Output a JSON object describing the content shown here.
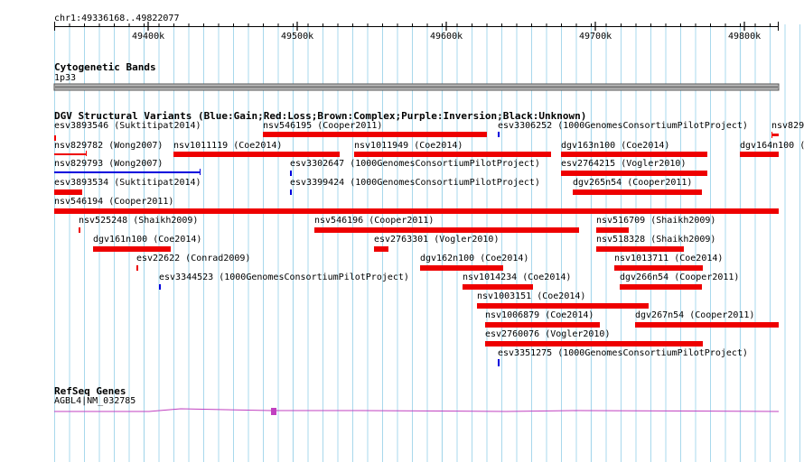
{
  "colors": {
    "gridline": "#a8d8ec",
    "loss": "#ee0000",
    "gain": "#0000dd",
    "gene": "#c040c0",
    "band": "#888888",
    "ruler": "#000000"
  },
  "ruler": {
    "title": "chr1:49336168..49822077",
    "ticks": [
      "49400k",
      "49500k",
      "49600k",
      "49700k",
      "49800k"
    ]
  },
  "cytoband": {
    "title": "Cytogenetic Bands",
    "band_label": "1p33"
  },
  "dgv": {
    "title": "DGV Structural Variants (Blue:Gain;Red:Loss;Brown:Complex;Purple:Inversion;Black:Unknown)",
    "features": [
      {
        "label": "esv3893546 (Suktitipat2014)",
        "type": "loss"
      },
      {
        "label": "nsv546195 (Cooper2011)",
        "type": "loss"
      },
      {
        "label": "esv3306252 (1000GenomesConsortiumPilotProject)",
        "type": "gain"
      },
      {
        "label": "nsv829",
        "type": "loss"
      },
      {
        "label": "nsv829782 (Wong2007)",
        "type": "loss"
      },
      {
        "label": "nsv1011119 (Coe2014)",
        "type": "loss"
      },
      {
        "label": "nsv1011949 (Coe2014)",
        "type": "loss"
      },
      {
        "label": "dgv163n100 (Coe2014)",
        "type": "loss"
      },
      {
        "label": "dgv164n100 (Co",
        "type": "loss"
      },
      {
        "label": "nsv829793 (Wong2007)",
        "type": "gain"
      },
      {
        "label": "esv3302647 (1000GenomesConsortiumPilotProject)",
        "type": "gain"
      },
      {
        "label": "esv2764215 (Vogler2010)",
        "type": "loss"
      },
      {
        "label": "esv3893534 (Suktitipat2014)",
        "type": "loss"
      },
      {
        "label": "esv3399424 (1000GenomesConsortiumPilotProject)",
        "type": "gain"
      },
      {
        "label": "dgv265n54 (Cooper2011)",
        "type": "loss"
      },
      {
        "label": "nsv546194 (Cooper2011)",
        "type": "loss"
      },
      {
        "label": "nsv525248 (Shaikh2009)",
        "type": "loss"
      },
      {
        "label": "nsv546196 (Cooper2011)",
        "type": "loss"
      },
      {
        "label": "nsv516709 (Shaikh2009)",
        "type": "loss"
      },
      {
        "label": "dgv161n100 (Coe2014)",
        "type": "loss"
      },
      {
        "label": "esv2763301 (Vogler2010)",
        "type": "loss"
      },
      {
        "label": "nsv518328 (Shaikh2009)",
        "type": "loss"
      },
      {
        "label": "esv22622 (Conrad2009)",
        "type": "loss"
      },
      {
        "label": "dgv162n100 (Coe2014)",
        "type": "loss"
      },
      {
        "label": "nsv1013711 (Coe2014)",
        "type": "loss"
      },
      {
        "label": "esv3344523 (1000GenomesConsortiumPilotProject)",
        "type": "gain"
      },
      {
        "label": "nsv1014234 (Coe2014)",
        "type": "loss"
      },
      {
        "label": "dgv266n54 (Cooper2011)",
        "type": "loss"
      },
      {
        "label": "nsv1003151 (Coe2014)",
        "type": "loss"
      },
      {
        "label": "nsv1006879 (Coe2014)",
        "type": "loss"
      },
      {
        "label": "dgv267n54 (Cooper2011)",
        "type": "loss"
      },
      {
        "label": "esv2760076 (Vogler2010)",
        "type": "loss"
      },
      {
        "label": "esv3351275 (1000GenomesConsortiumPilotProject)",
        "type": "gain"
      }
    ]
  },
  "refseq": {
    "title": "RefSeq Genes",
    "gene_label": "AGBL4|NM_032785"
  }
}
